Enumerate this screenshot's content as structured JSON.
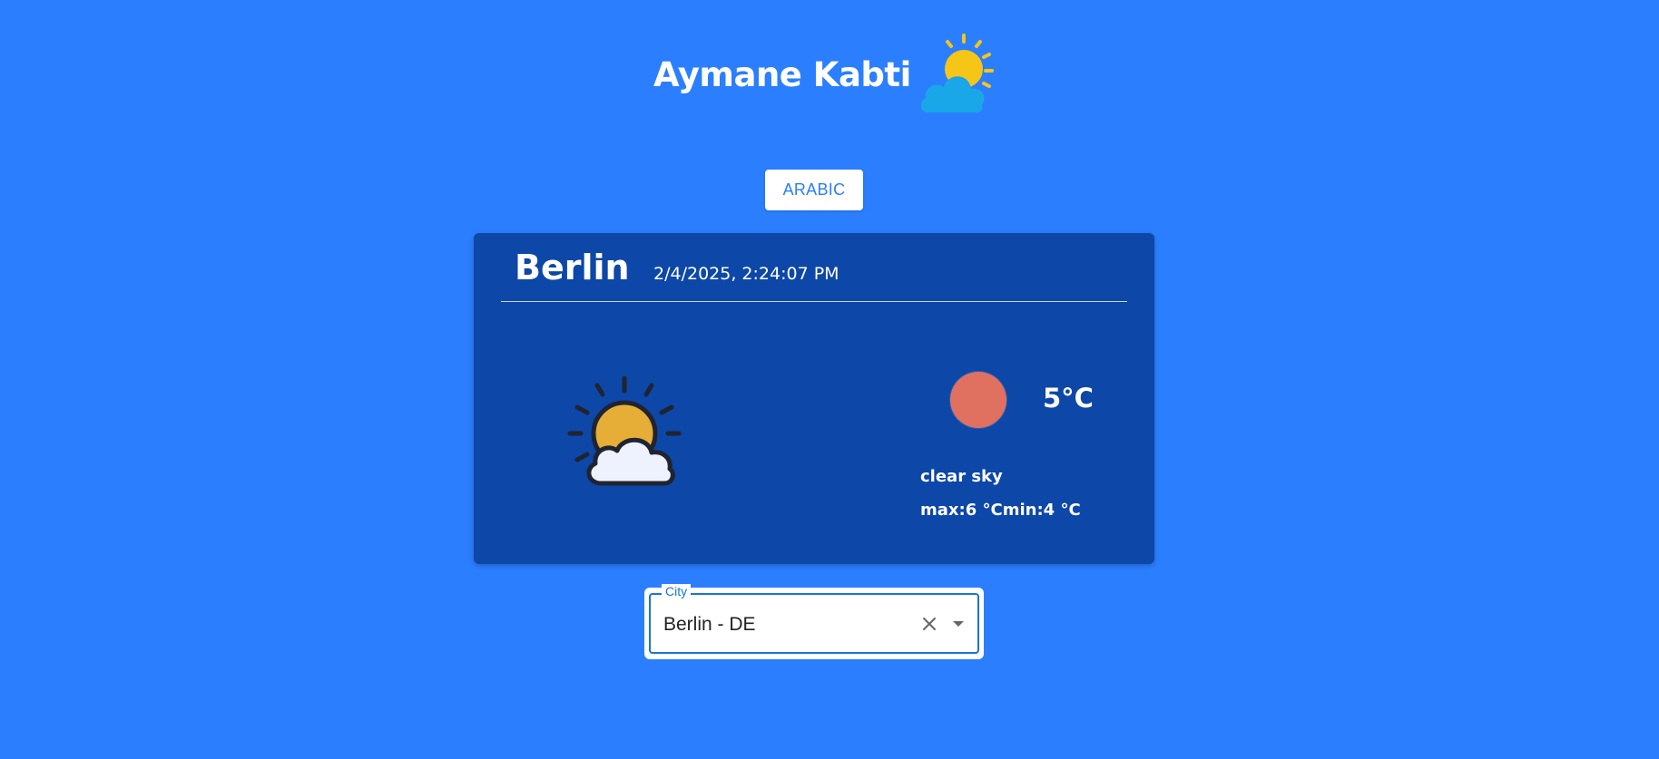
{
  "header": {
    "title": "Aymane Kabti",
    "logo_icon": "sun-behind-cloud-icon"
  },
  "language_button": {
    "label": "ARABIC"
  },
  "weather_card": {
    "city": "Berlin",
    "datetime": "2/4/2025, 2:24:07 PM",
    "condition_icon": "partly-cloudy-icon",
    "temperature": "5°C",
    "temperature_indicator_color": "#e07060",
    "description": "clear sky",
    "minmax": "max:6 °Cmin:4 °C"
  },
  "city_select": {
    "label": "City",
    "value": "Berlin - DE",
    "clear_icon": "close-icon",
    "dropdown_icon": "caret-down-icon"
  },
  "colors": {
    "page_background": "#2b7fff",
    "card_background": "#0d47a8",
    "accent": "#1976d2",
    "sun": "#f2b830",
    "cloud": "#1aa7e8"
  }
}
